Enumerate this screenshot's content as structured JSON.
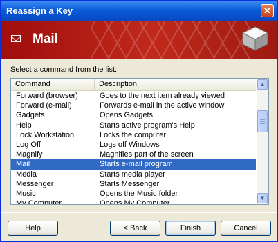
{
  "window": {
    "title": "Reassign a Key",
    "close_glyph": "✕"
  },
  "banner": {
    "title": "Mail",
    "icon": "envelope-icon",
    "accent": "#b0170f"
  },
  "prompt": "Select a command from the list:",
  "list": {
    "columns": [
      "Command",
      "Description"
    ],
    "rows": [
      {
        "command": "Forward (browser)",
        "description": "Goes to the next item already viewed"
      },
      {
        "command": "Forward (e-mail)",
        "description": "Forwards e-mail in the active window"
      },
      {
        "command": "Gadgets",
        "description": "Opens Gadgets"
      },
      {
        "command": "Help",
        "description": "Starts active program's Help"
      },
      {
        "command": "Lock Workstation",
        "description": "Locks the computer"
      },
      {
        "command": "Log Off",
        "description": "Logs off Windows"
      },
      {
        "command": "Magnify",
        "description": "Magnifies part of the screen"
      },
      {
        "command": "Mail",
        "description": "Starts e-mail program",
        "selected": true
      },
      {
        "command": "Media",
        "description": "Starts media player"
      },
      {
        "command": "Messenger",
        "description": "Starts Messenger"
      },
      {
        "command": "Music",
        "description": "Opens the Music folder"
      },
      {
        "command": "My Computer",
        "description": "Opens My Computer"
      }
    ],
    "selection_color": "#316ac5"
  },
  "buttons": {
    "help": "Help",
    "back": "< Back",
    "finish": "Finish",
    "cancel": "Cancel"
  }
}
